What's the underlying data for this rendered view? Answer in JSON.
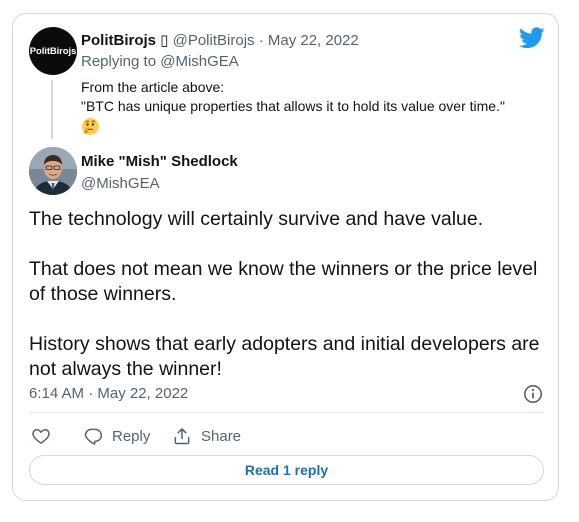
{
  "quoted_tweet": {
    "avatar_text": "PolitBirojs",
    "name": "PolitBirojs ▯",
    "meta": "@PolitBirojs · May 22, 2022",
    "replying_label": "Replying to ",
    "replying_handle": "@MishGEA",
    "text_line1": "From the article above:",
    "text_line2": "\"BTC has unique properties that allows it to hold its value over time.\"",
    "emoji": "thinking-face"
  },
  "main_tweet": {
    "name": "Mike \"Mish\" Shedlock",
    "handle": "@MishGEA",
    "paragraphs": [
      "The technology will certainly survive and have value.",
      "That does not mean we know the winners or the price level of those winners.",
      "History shows that early adopters and initial developers are not always the winner!"
    ],
    "timestamp": "6:14 AM · May 22, 2022"
  },
  "actions": {
    "reply_label": "Reply",
    "share_label": "Share",
    "read_replies_label": "Read 1 reply"
  },
  "colors": {
    "twitter_blue": "#1d9bf0",
    "link_blue": "#1d6fb8",
    "secondary_text": "#536471",
    "border": "#cfd9de"
  }
}
